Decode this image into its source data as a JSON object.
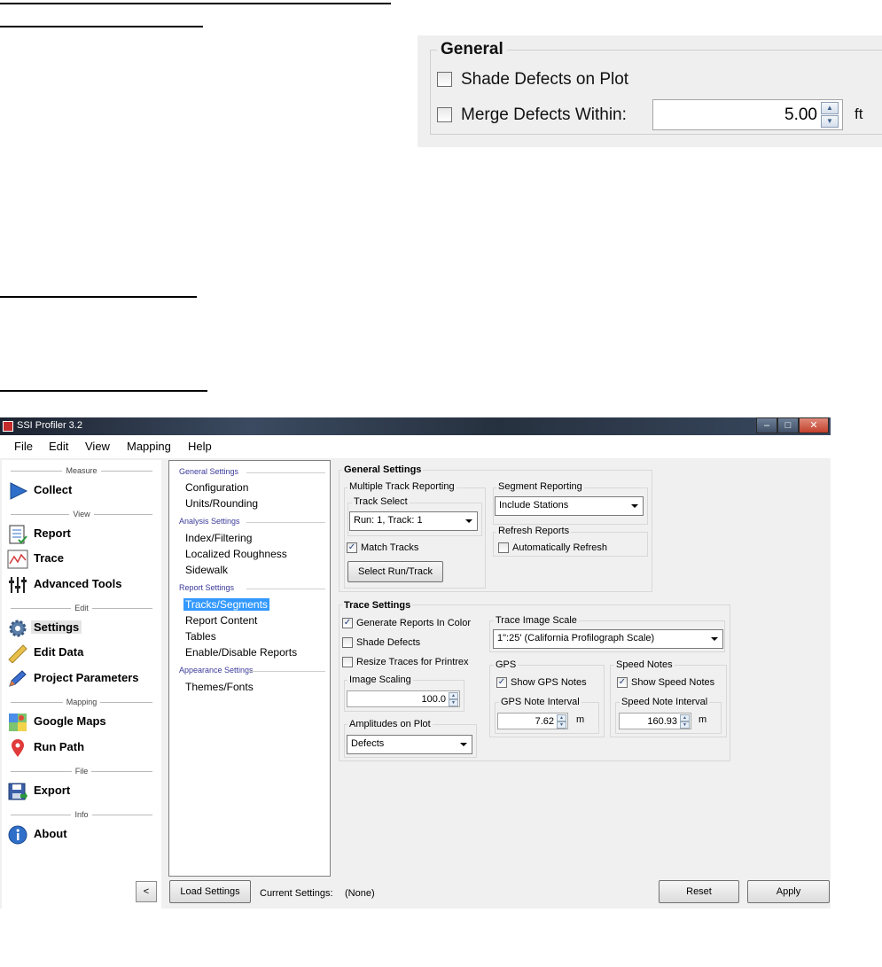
{
  "zoom_panel": {
    "legend": "General",
    "shade_label": "Shade Defects on Plot",
    "merge_label": "Merge Defects Within:",
    "merge_value": "5.00",
    "merge_unit": "ft"
  },
  "window": {
    "title": "SSI Profiler 3.2",
    "controls": {
      "minimize": "–",
      "maximize": "□",
      "close": "✕"
    }
  },
  "menu": [
    "File",
    "Edit",
    "View",
    "Mapping",
    "Help"
  ],
  "sidebar": {
    "sections": {
      "measure": "Measure",
      "view": "View",
      "edit": "Edit",
      "mapping": "Mapping",
      "file": "File",
      "info": "Info"
    },
    "items": {
      "collect": "Collect",
      "report": "Report",
      "trace": "Trace",
      "advanced_tools": "Advanced Tools",
      "settings": "Settings",
      "edit_data": "Edit Data",
      "project_parameters": "Project Parameters",
      "google_maps": "Google Maps",
      "run_path": "Run Path",
      "export": "Export",
      "about": "About"
    },
    "collapse": "<"
  },
  "tree": {
    "general_group": "General Settings",
    "configuration": "Configuration",
    "units_rounding": "Units/Rounding",
    "analysis_group": "Analysis Settings",
    "index_filtering": "Index/Filtering",
    "localized_roughness": "Localized Roughness",
    "sidewalk": "Sidewalk",
    "report_group": "Report Settings",
    "tracks_segments": "Tracks/Segments",
    "report_content": "Report Content",
    "tables": "Tables",
    "enable_disable": "Enable/Disable Reports",
    "appearance_group": "Appearance Settings",
    "themes_fonts": "Themes/Fonts"
  },
  "general_settings": {
    "title": "General Settings",
    "multiple_track_reporting": "Multiple Track Reporting",
    "track_select": "Track Select",
    "track_select_value": "Run: 1, Track: 1",
    "match_tracks": "Match Tracks",
    "match_tracks_checked": true,
    "select_run_track": "Select Run/Track",
    "segment_reporting": "Segment Reporting",
    "segment_reporting_value": "Include Stations",
    "refresh_reports": "Refresh Reports",
    "automatically_refresh": "Automatically Refresh"
  },
  "trace_settings": {
    "title": "Trace Settings",
    "generate_color": "Generate Reports In Color",
    "generate_color_checked": true,
    "shade_defects": "Shade Defects",
    "resize_traces": "Resize Traces for Printrex",
    "image_scaling": "Image Scaling",
    "image_scaling_value": "100.0",
    "amplitudes_on_plot": "Amplitudes on Plot",
    "amplitudes_value": "Defects",
    "trace_image_scale": "Trace Image Scale",
    "trace_image_scale_value": "1\":25' (California Profilograph Scale)",
    "gps": "GPS",
    "show_gps_notes": "Show GPS Notes",
    "gps_note_interval": "GPS Note Interval",
    "gps_interval_value": "7.62",
    "gps_unit": "m",
    "speed_notes": "Speed Notes",
    "show_speed_notes": "Show Speed Notes",
    "speed_note_interval": "Speed Note Interval",
    "speed_interval_value": "160.93",
    "speed_unit": "m"
  },
  "footer": {
    "load_settings": "Load Settings",
    "current_settings_label": "Current Settings:",
    "current_settings_value": "(None)",
    "reset": "Reset",
    "apply": "Apply"
  },
  "checkmark": "✓"
}
